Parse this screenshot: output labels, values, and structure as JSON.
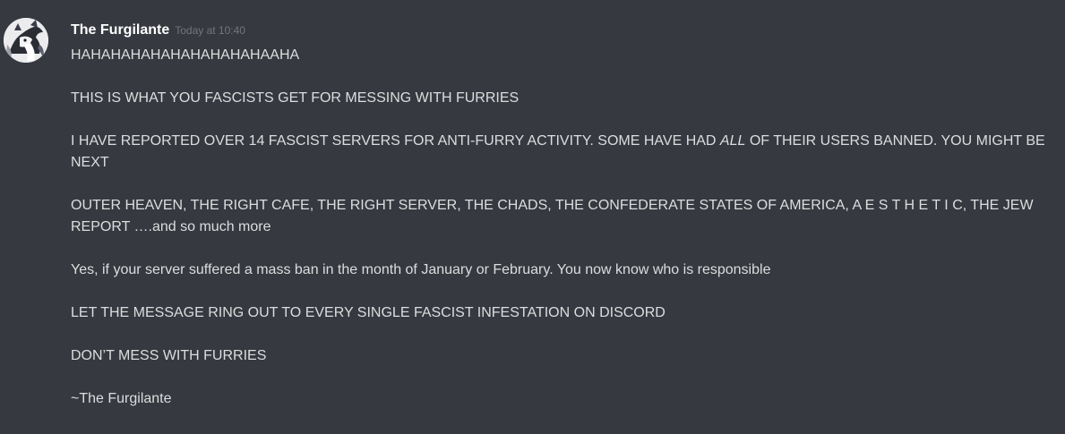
{
  "message": {
    "author": "The Furgilante",
    "timestamp": "Today at 10:40",
    "lines": {
      "l1": "HAHAHAHAHAHAHAHAHAHAAHA",
      "l2": "THIS IS WHAT YOU FASCISTS GET FOR MESSING WITH FURRIES",
      "l3_before": "I HAVE REPORTED OVER 14 FASCIST SERVERS FOR ANTI-FURRY ACTIVITY. SOME HAVE HAD ",
      "l3_emphasis": "ALL",
      "l3_after": " OF THEIR USERS BANNED. YOU MIGHT BE NEXT",
      "l4": "OUTER HEAVEN, THE RIGHT CAFE, THE RIGHT SERVER, THE CHADS, THE CONFEDERATE STATES OF AMERICA, A E S T H E T I C, THE JEW REPORT ….and so much more",
      "l5": "Yes, if your server suffered a mass ban in the month of January or February. You now know who is responsible",
      "l6": "LET THE MESSAGE RING OUT TO EVERY SINGLE FASCIST INFESTATION ON DISCORD",
      "l7": "DON’T MESS WITH FURRIES",
      "l8": "~The Furgilante"
    }
  },
  "avatar": {
    "icon": "furry-character-avatar"
  },
  "colors": {
    "background": "#36393f",
    "username": "#ffffff",
    "timestamp": "#72767d",
    "text": "#dcddde"
  }
}
